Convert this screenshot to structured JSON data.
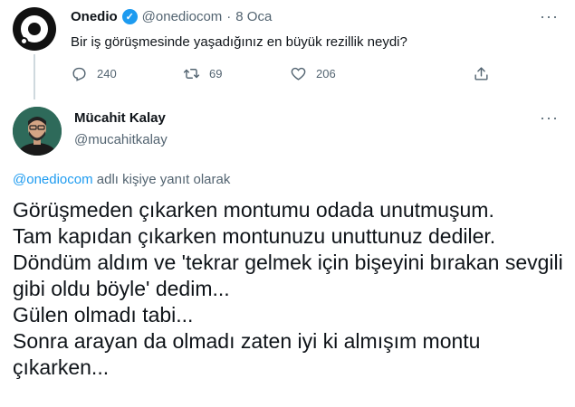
{
  "parent_tweet": {
    "author_name": "Onedio",
    "handle": "@onediocom",
    "separator": "·",
    "date": "8 Oca",
    "text": "Bir iş görüşmesinde yaşadığınız en büyük rezillik neydi?",
    "replies": "240",
    "retweets": "69",
    "likes": "206",
    "more_label": "···"
  },
  "reply_tweet": {
    "author_name": "Mücahit Kalay",
    "handle": "@mucahitkalay",
    "more_label": "···",
    "replying_mention": "@onediocom",
    "replying_suffix": " adlı kişiye yanıt olarak",
    "text": "Görüşmeden çıkarken montumu odada unutmuşum.\nTam kapıdan çıkarken montunuzu unuttunuz dediler.\nDöndüm aldım ve 'tekrar gelmek için bişeyini bırakan sevgili gibi oldu böyle' dedim...\nGülen olmadı tabi...\nSonra arayan da olmadı zaten iyi ki almışım montu çıkarken..."
  },
  "colors": {
    "accent": "#1d9bf0",
    "text_primary": "#0f1419",
    "text_secondary": "#536471",
    "thread_line": "#cfd9de"
  },
  "icons": {
    "verified": "verified-badge-icon",
    "reply": "reply-icon",
    "retweet": "retweet-icon",
    "like": "heart-icon",
    "share": "share-icon",
    "more": "more-icon"
  }
}
